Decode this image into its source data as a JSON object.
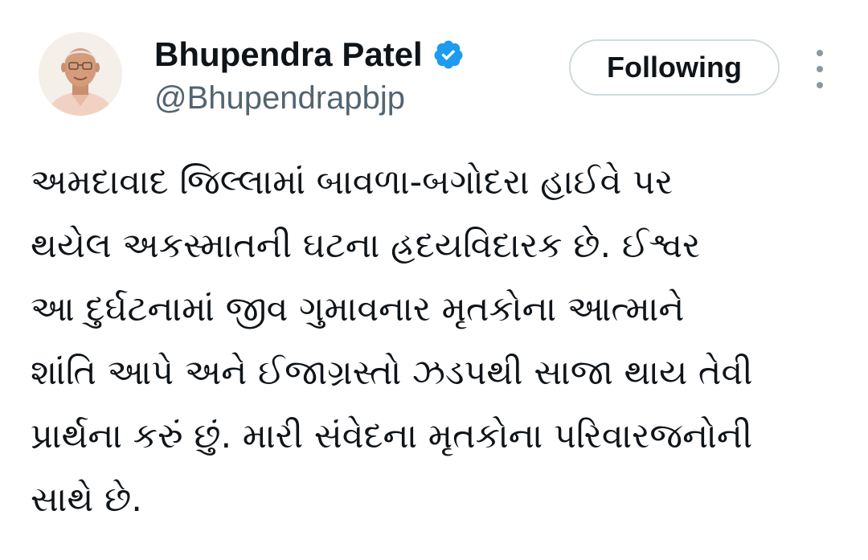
{
  "author": {
    "display_name": "Bhupendra Patel",
    "handle": "@Bhupendrapbjp",
    "verified": true,
    "verified_badge_color": "#1d9bf0",
    "avatar_icon": "profile-photo"
  },
  "actions": {
    "follow_label": "Following",
    "more_icon": "more-vertical-icon"
  },
  "tweet": {
    "lines": [
      "અમદાવાદ જિલ્લામાં બાવળા-બગોદરા હાઈવે પર",
      "થયેલ અકસ્માતની ઘટના હ્રદયવિદારક છે. ઈશ્વર",
      "આ દુર્ઘટનામાં જીવ ગુમાવનાર મૃતકોના આત્માને",
      "શાંતિ આપે અને ઈજાગ્રસ્તો ઝડપથી સાજા થાય તેવી",
      "પ્રાર્થના કરું છું. મારી સંવેદના મૃતકોના પરિવારજનોની",
      "સાથે છે."
    ]
  }
}
